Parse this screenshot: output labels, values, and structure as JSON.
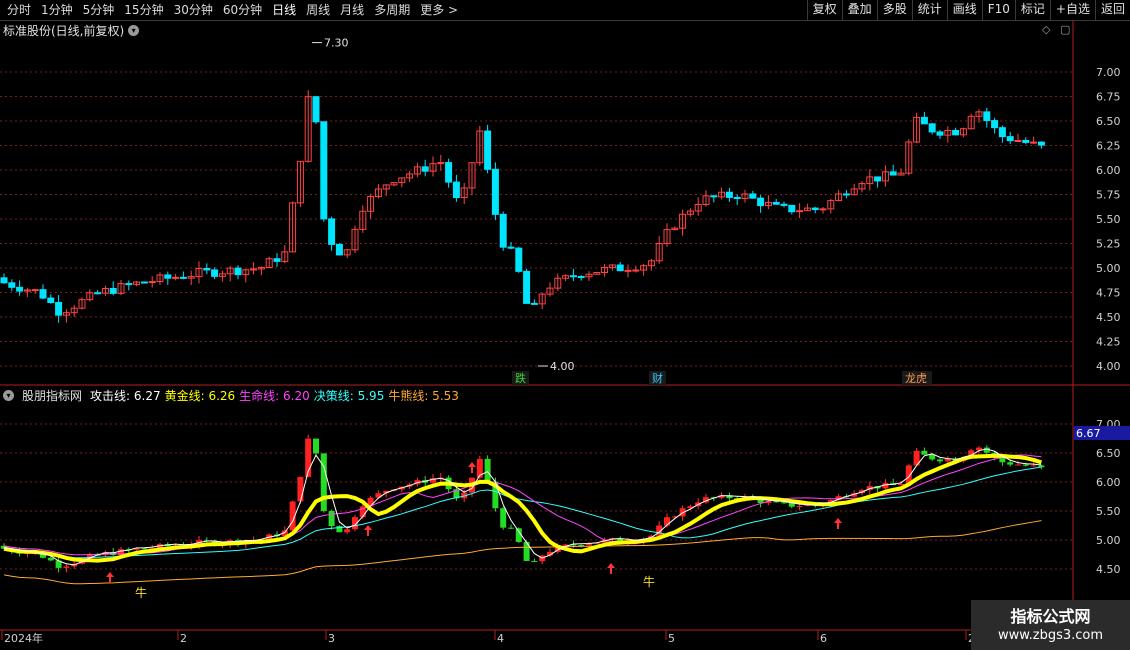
{
  "toolbar": {
    "periods": [
      "分时",
      "1分钟",
      "5分钟",
      "15分钟",
      "30分钟",
      "60分钟",
      "日线",
      "周线",
      "月线",
      "多周期",
      "更多 >"
    ],
    "active_period": "日线",
    "actions": [
      "复权",
      "叠加",
      "多股",
      "统计",
      "画线",
      "F10",
      "标记",
      "+自选",
      "返回"
    ]
  },
  "main_panel": {
    "title": "标准股份(日线,前复权)",
    "high_label": "7.30",
    "low_label": "4.00",
    "price_ticks": [
      "7.00",
      "6.75",
      "6.50",
      "6.25",
      "6.00",
      "5.75",
      "5.50",
      "5.25",
      "5.00",
      "4.75",
      "4.50",
      "4.25",
      "4.00"
    ],
    "event_markers": [
      {
        "text": "跌",
        "color": "#33dd33"
      },
      {
        "text": "财",
        "color": "#33ccff"
      },
      {
        "text": "龙虎",
        "color": "#ff9955"
      }
    ]
  },
  "indicator_panel": {
    "name": "股朋指标网",
    "lines": [
      {
        "label": "攻击线:",
        "value": "6.27",
        "color": "#ffffff"
      },
      {
        "label": "黄金线:",
        "value": "6.26",
        "color": "#ffff00"
      },
      {
        "label": "生命线:",
        "value": "6.20",
        "color": "#ff44ff"
      },
      {
        "label": "决策线:",
        "value": "5.95",
        "color": "#33ffff"
      },
      {
        "label": "牛熊线:",
        "value": "5.53",
        "color": "#ffaa33"
      }
    ],
    "ticks": [
      "7.00",
      "6.50",
      "6.00",
      "5.50",
      "5.00",
      "4.50"
    ],
    "current_value": "6.67",
    "bull_label": "牛"
  },
  "date_axis": {
    "labels": [
      "2024年",
      "2",
      "3",
      "4",
      "5",
      "6",
      "2"
    ]
  },
  "colors": {
    "up": "#ff4444",
    "down": "#00e5ff",
    "grid": "#7a1f1f",
    "axis_text": "#d0d0d0",
    "highlight_box": "#1a1aa0"
  },
  "icons": [
    "chevron-down-icon",
    "diamond-icon",
    "square-icon",
    "right-arrow-icon"
  ],
  "watermark": {
    "line1": "指标公式网",
    "line2": "www.zbgs3.com"
  }
}
